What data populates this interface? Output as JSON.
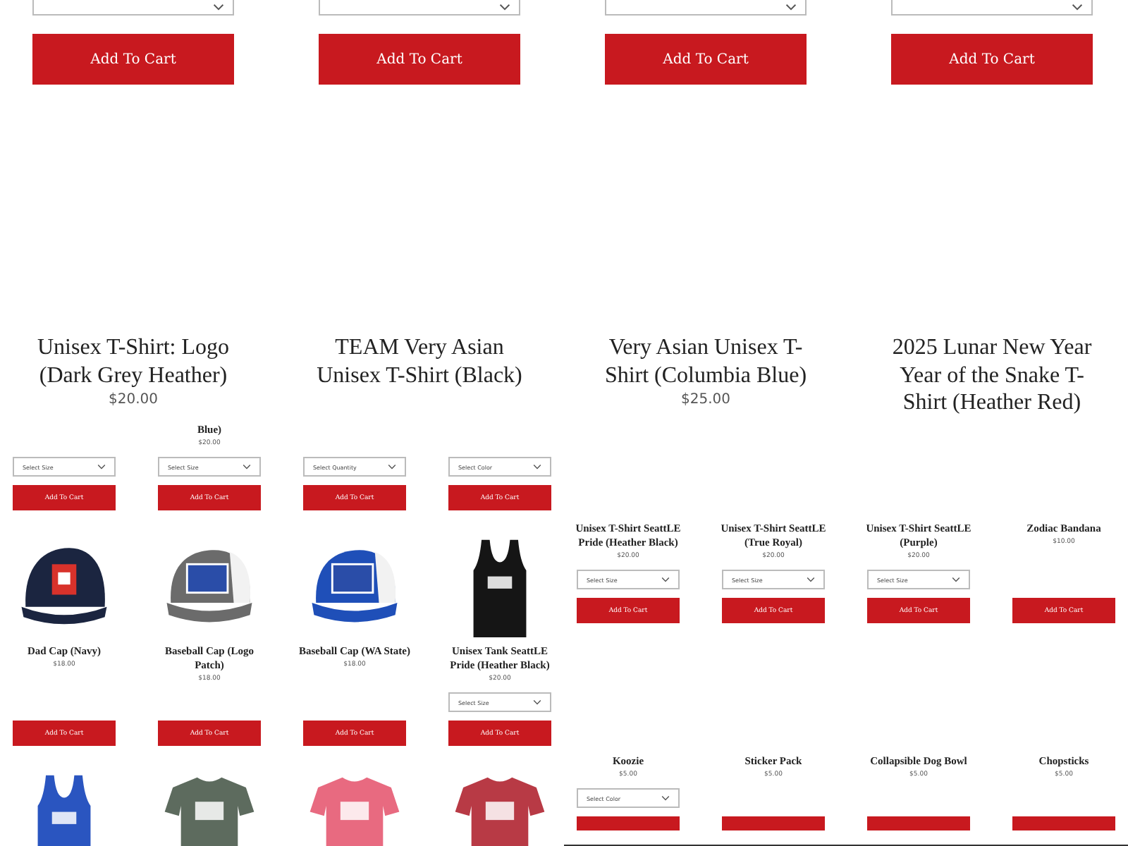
{
  "top": {
    "rows": [
      [
        {
          "select": {
            "clipped": true
          },
          "button": {
            "label": "Add To Cart"
          }
        },
        {
          "select": {
            "clipped": true
          },
          "button": {
            "label": "Add To Cart"
          }
        },
        {
          "select": {
            "clipped": true
          },
          "button": {
            "label": "Add To Cart"
          }
        },
        {
          "select": {
            "clipped": true
          },
          "button": {
            "label": "Add To Cart"
          }
        }
      ],
      [
        {
          "title": "Unisex T-Shirt: Logo (Dark Grey Heather)",
          "price": "$20.00"
        },
        {
          "title": "TEAM Very Asian Unisex T-Shirt (Black)"
        },
        {
          "title": "Very Asian Unisex T-Shirt (Columbia Blue)",
          "price": "$25.00"
        },
        {
          "title": "2025 Lunar New Year Year of the Snake T-Shirt (Heather Red)"
        }
      ]
    ]
  },
  "left": {
    "rows": [
      [
        {
          "select": {
            "placeholder": "Select Size"
          },
          "button": {
            "label": "Add To Cart"
          }
        },
        {
          "title": "Blue)",
          "price": "$20.00",
          "select": {
            "placeholder": "Select Size"
          },
          "button": {
            "label": "Add To Cart"
          }
        },
        {
          "select": {
            "placeholder": "Select Quantity"
          },
          "button": {
            "label": "Add To Cart"
          }
        },
        {
          "select": {
            "placeholder": "Select Color"
          },
          "button": {
            "label": "Add To Cart"
          }
        }
      ],
      [
        {
          "image": {
            "kind": "cap",
            "color": "#1b2540"
          },
          "title": "Dad Cap (Navy)",
          "price": "$18.00",
          "button": {
            "label": "Add To Cart"
          }
        },
        {
          "image": {
            "kind": "trucker-cap",
            "color": "#6b6b6b"
          },
          "title": "Baseball Cap (Logo Patch)",
          "price": "$18.00",
          "button": {
            "label": "Add To Cart"
          }
        },
        {
          "image": {
            "kind": "trucker-cap",
            "color": "#1f4fb8"
          },
          "title": "Baseball Cap (WA State)",
          "price": "$18.00",
          "button": {
            "label": "Add To Cart"
          }
        },
        {
          "image": {
            "kind": "tank",
            "color": "#151515"
          },
          "title": "Unisex Tank SeattLE Pride (Heather Black)",
          "price": "$20.00",
          "select": {
            "placeholder": "Select Size"
          },
          "button": {
            "label": "Add To Cart"
          }
        }
      ],
      [
        {
          "image": {
            "kind": "tank",
            "color": "#2a55c0"
          }
        },
        {
          "image": {
            "kind": "tshirt",
            "color": "#5d6b5e"
          }
        },
        {
          "image": {
            "kind": "tshirt",
            "color": "#e86a80"
          }
        },
        {
          "image": {
            "kind": "tshirt",
            "color": "#b83a45"
          }
        }
      ]
    ]
  },
  "right": {
    "rows": [
      [
        {
          "title": "Unisex T-Shirt SeattLE Pride (Heather Black)",
          "price": "$20.00",
          "select": {
            "placeholder": "Select Size"
          },
          "button": {
            "label": "Add To Cart"
          }
        },
        {
          "title": "Unisex T-Shirt SeattLE (True Royal)",
          "price": "$20.00",
          "select": {
            "placeholder": "Select Size"
          },
          "button": {
            "label": "Add To Cart"
          }
        },
        {
          "title": "Unisex T-Shirt SeattLE (Purple)",
          "price": "$20.00",
          "select": {
            "placeholder": "Select Size"
          },
          "button": {
            "label": "Add To Cart"
          }
        },
        {
          "title": "Zodiac Bandana",
          "price": "$10.00",
          "button": {
            "label": "Add To Cart"
          }
        }
      ],
      [
        {
          "title": "Koozie",
          "price": "$5.00",
          "select": {
            "placeholder": "Select Color"
          },
          "button": {
            "clipped": true
          }
        },
        {
          "title": "Sticker Pack",
          "price": "$5.00",
          "button": {
            "clipped": true
          }
        },
        {
          "title": "Collapsible Dog Bowl",
          "price": "$5.00",
          "button": {
            "clipped": true
          }
        },
        {
          "title": "Chopsticks",
          "price": "$5.00",
          "button": {
            "clipped": true
          }
        }
      ]
    ]
  }
}
